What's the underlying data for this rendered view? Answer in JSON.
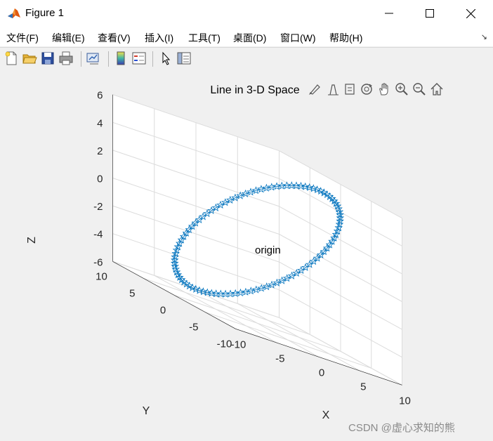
{
  "window": {
    "title": "Figure 1",
    "minimize_icon": "minimize-icon",
    "maximize_icon": "maximize-icon",
    "close_icon": "close-icon"
  },
  "menu": {
    "items": [
      "文件(F)",
      "编辑(E)",
      "查看(V)",
      "插入(I)",
      "工具(T)",
      "桌面(D)",
      "窗口(W)",
      "帮助(H)"
    ],
    "dock_icon": "dock-arrow-icon"
  },
  "toolbar": {
    "icons": [
      "new-figure-icon",
      "open-file-icon",
      "save-icon",
      "print-icon",
      "link-plot-icon",
      "colorbar-icon",
      "legend-icon",
      "pointer-icon",
      "property-inspector-icon"
    ]
  },
  "axes_toolbar": {
    "icons": [
      "brush-icon",
      "data-tips-icon",
      "export-icon",
      "rotate-3d-icon",
      "pan-icon",
      "zoom-in-icon",
      "zoom-out-icon",
      "home-icon"
    ]
  },
  "chart_data": {
    "type": "line3d",
    "title": "Line in 3-D Space",
    "xlabel": "X",
    "ylabel": "Y",
    "zlabel": "Z",
    "xlim": [
      -10,
      10
    ],
    "ylim": [
      -10,
      10
    ],
    "zlim": [
      -6,
      6
    ],
    "xticks": [
      "-10",
      "-5",
      "0",
      "5",
      "10"
    ],
    "yticks": [
      "-10",
      "-5",
      "0",
      "5",
      "10"
    ],
    "zticks": [
      "-6",
      "-4",
      "-2",
      "0",
      "2",
      "4",
      "6"
    ],
    "grid": true,
    "view": "default 3-D view (azimuth -37.5, elevation 30)",
    "series": [
      {
        "kind": "circle",
        "x": "8*cos(t)",
        "y": "8*sin(t)",
        "z": "5*cos(t)",
        "t_range": [
          0,
          6.283
        ],
        "points": 100,
        "marker": "pentagram",
        "color": "#0072bd"
      }
    ],
    "annotations": [
      {
        "text": "origin",
        "x": 0,
        "y": 0,
        "z": 0
      }
    ]
  },
  "watermark": "CSDN @虚心求知的熊"
}
